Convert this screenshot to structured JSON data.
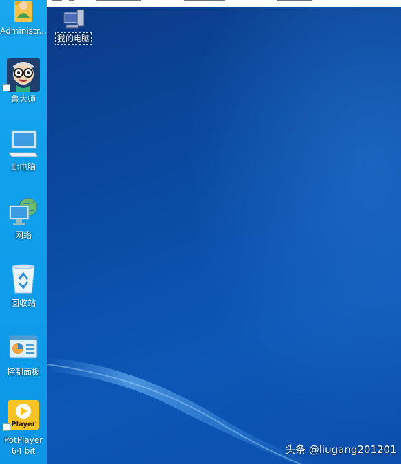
{
  "desktop": {
    "icons": [
      {
        "label": "Administr...",
        "icon": "user-folder-icon"
      },
      {
        "label": "鲁大师",
        "icon": "ludashi-icon"
      },
      {
        "label": "此电脑",
        "icon": "computer-icon"
      },
      {
        "label": "网络",
        "icon": "network-icon"
      },
      {
        "label": "回收站",
        "icon": "recycle-bin-icon"
      },
      {
        "label": "控制面板",
        "icon": "control-panel-icon"
      },
      {
        "label": "PotPlayer",
        "label2": "64 bit",
        "icon": "potplayer-icon",
        "badge": "Player"
      }
    ]
  },
  "inner_desktop": {
    "icon_label": "我的电脑",
    "icon": "my-computer-icon"
  },
  "watermark": "头条 @liugang201201",
  "colors": {
    "strip": "#10a0ec",
    "wallpaper": "#0a4ba4",
    "potplayer": "#f7c325"
  }
}
